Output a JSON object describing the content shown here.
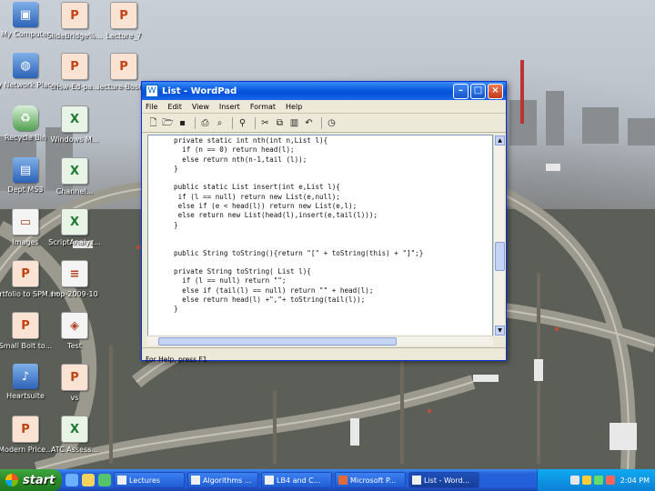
{
  "desktop_icons": [
    {
      "label": "My Computer",
      "icon": "computer-icon"
    },
    {
      "label": "SlideBridge%...",
      "icon": "ppt-file-icon"
    },
    {
      "label": "Lecture_7",
      "icon": "ppt-file-icon"
    },
    {
      "label": "My Network Places",
      "icon": "network-icon"
    },
    {
      "label": "chsw-Ed-pa...",
      "icon": "ppt-file-icon"
    },
    {
      "label": "lecture-Bosh...",
      "icon": "ppt-file-icon"
    },
    {
      "label": "Recycle Bin",
      "icon": "recycle-bin-icon"
    },
    {
      "label": "Windows M...",
      "icon": "xls-file-icon"
    },
    {
      "label": "Dept MS3",
      "icon": "folder-icon"
    },
    {
      "label": "Channel...",
      "icon": "xls-file-icon"
    },
    {
      "label": "Images",
      "icon": "image-icon"
    },
    {
      "label": "ScriptAnalyz...",
      "icon": "xls-file-icon"
    },
    {
      "label": "Portfolio to SPM.sm",
      "icon": "ppt-file-icon"
    },
    {
      "label": "hop-2009-10",
      "icon": "document-icon"
    },
    {
      "label": "Small Bolt to...",
      "icon": "ppt-file-icon"
    },
    {
      "label": "Test",
      "icon": "game-icon"
    },
    {
      "label": "Heartsuite",
      "icon": "music-icon"
    },
    {
      "label": "vs",
      "icon": "ppt-file-icon"
    },
    {
      "label": "Modern Price...",
      "icon": "ppt-file-icon"
    },
    {
      "label": "ATC Assess...",
      "icon": "xls-file-icon"
    }
  ],
  "window": {
    "title": "List - WordPad",
    "menu": [
      "File",
      "Edit",
      "View",
      "Insert",
      "Format",
      "Help"
    ],
    "toolbar_icons": [
      "new-icon",
      "open-icon",
      "save-icon",
      "print-icon",
      "print-preview-icon",
      "find-icon",
      "cut-icon",
      "copy-icon",
      "paste-icon",
      "undo-icon",
      "datetime-icon"
    ],
    "code": "private static int nth(int n,List l){\n  if (n == 0) return head(l);\n  else return nth(n-1,tail (l));\n}\n\npublic static List insert(int e,List l){\n if (l == null) return new List(e,null);\n else if (e < head(l)) return new List(e,l);\n else return new List(head(l),insert(e,tail(l)));\n}\n\n\npublic String toString(){return \"[\" + toString(this) + \"]\";}\n\nprivate String toString( List l){\n  if (l == null) return \"\";\n  else if (tail(l) == null) return \"\" + head(l);\n  else return head(l) +\",\"+ toString(tail(l));\n}",
    "status": "For Help, press F1"
  },
  "taskbar": {
    "start_label": "start",
    "tasks": [
      {
        "label": "Lectures",
        "active": false
      },
      {
        "label": "Algorithms ...",
        "active": false
      },
      {
        "label": "LB4 and C...",
        "active": false
      },
      {
        "label": "Microsoft P...",
        "active": false
      },
      {
        "label": "List - Word...",
        "active": true
      }
    ],
    "clock": "2:04 PM"
  }
}
